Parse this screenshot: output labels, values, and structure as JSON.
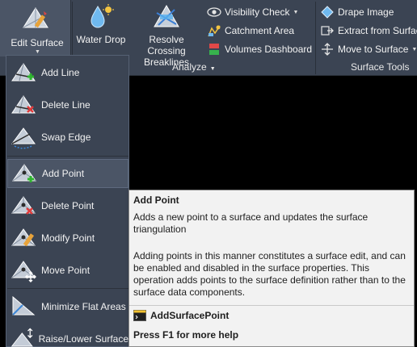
{
  "ribbon": {
    "edit_surface_label": "Edit Surface",
    "water_drop_label": "Water Drop",
    "resolve_crossing_label_line1": "Resolve Crossing",
    "resolve_crossing_label_line2": "Breaklines",
    "visibility_check_label": "Visibility Check",
    "catchment_area_label": "Catchment Area",
    "volumes_dashboard_label": "Volumes Dashboard",
    "analyze_panel_label": "Analyze",
    "drape_image_label": "Drape Image",
    "extract_from_surface_label": "Extract from Surfac",
    "move_to_surface_label": "Move to Surface",
    "surface_tools_panel_label": "Surface Tools"
  },
  "menu": {
    "items": [
      {
        "label": "Add Line",
        "icon": "add-line-icon"
      },
      {
        "label": "Delete Line",
        "icon": "delete-line-icon"
      },
      {
        "label": "Swap Edge",
        "icon": "swap-edge-icon"
      },
      {
        "label": "Add Point",
        "icon": "add-point-icon"
      },
      {
        "label": "Delete Point",
        "icon": "delete-point-icon"
      },
      {
        "label": "Modify Point",
        "icon": "modify-point-icon"
      },
      {
        "label": "Move Point",
        "icon": "move-point-icon"
      },
      {
        "label": "Minimize Flat Areas",
        "icon": "minimize-flat-areas-icon"
      },
      {
        "label": "Raise/Lower Surface",
        "icon": "raise-lower-surface-icon"
      }
    ]
  },
  "tooltip": {
    "title": "Add Point",
    "description": "Adds a new point to a surface and updates the surface triangulation",
    "details": "Adding points in this manner constitutes a surface edit, and can be enabled and disabled in the surface properties. This operation adds points to the surface definition rather than to the surface data components.",
    "command": "AddSurfacePoint",
    "help": "Press F1 for more help"
  },
  "colors": {
    "ribbon_bg": "#3b4453",
    "highlight_bg": "#4b5566",
    "tooltip_bg": "#f2f2f2",
    "add_green": "#2fb52f",
    "delete_red": "#e23a3a"
  }
}
